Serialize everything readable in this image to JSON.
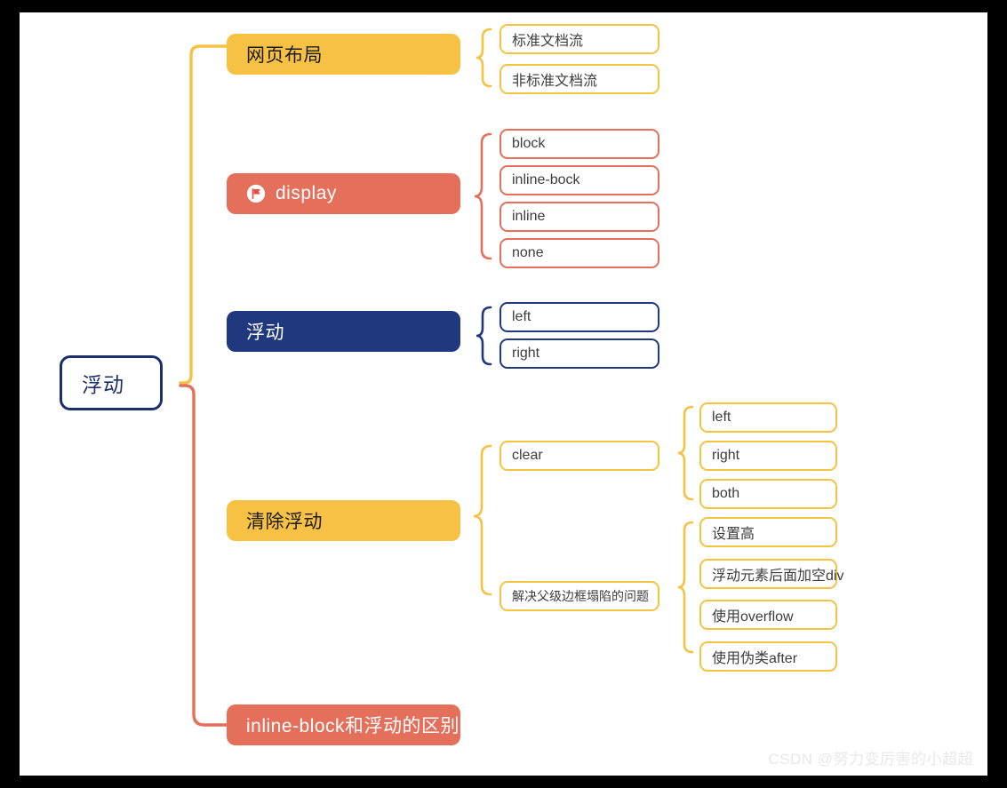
{
  "canvas": {
    "background": "#ffffff",
    "frame_color": "#000000",
    "watermark": "CSDN @努力变厉害的小超超"
  },
  "palette": {
    "amber": "#f7c244",
    "amber_border": "#f5c243",
    "salmon": "#e4705c",
    "navy": "#20387e",
    "root_border": "#1b2f6b",
    "leaf_text": "#3d3d3d",
    "watermark_gray": "#e8e8e8"
  },
  "chart_data": {
    "type": "diagram",
    "diagram_kind": "mind-map",
    "title": "浮动",
    "root": {
      "label": "浮动",
      "style": "outline-navy"
    },
    "branches": [
      {
        "label": "网页布局",
        "style": "filled-amber",
        "trunk": "amber",
        "children": [
          {
            "label": "标准文档流",
            "style": "outline-amber"
          },
          {
            "label": "非标准文档流",
            "style": "outline-amber"
          }
        ]
      },
      {
        "label": "display",
        "style": "filled-salmon",
        "icon": "flag-icon",
        "trunk": "amber",
        "children": [
          {
            "label": "block",
            "style": "outline-salmon"
          },
          {
            "label": "inline-bock",
            "style": "outline-salmon"
          },
          {
            "label": "inline",
            "style": "outline-salmon"
          },
          {
            "label": "none",
            "style": "outline-salmon"
          }
        ]
      },
      {
        "label": "浮动",
        "style": "filled-navy",
        "trunk": "amber",
        "children": [
          {
            "label": "left",
            "style": "outline-navy"
          },
          {
            "label": "right",
            "style": "outline-navy"
          }
        ]
      },
      {
        "label": "清除浮动",
        "style": "filled-amber",
        "trunk": "salmon",
        "children": [
          {
            "label": "clear",
            "style": "outline-amber",
            "children": [
              {
                "label": "left",
                "style": "outline-amber"
              },
              {
                "label": "right",
                "style": "outline-amber"
              },
              {
                "label": "both",
                "style": "outline-amber"
              }
            ]
          },
          {
            "label": "解决父级边框塌陷的问题",
            "style": "outline-amber",
            "small": true,
            "children": [
              {
                "label": "设置高",
                "style": "outline-amber"
              },
              {
                "label": "浮动元素后面加空div",
                "style": "outline-amber"
              },
              {
                "label": "使用overflow",
                "style": "outline-amber"
              },
              {
                "label": "使用伪类after",
                "style": "outline-amber"
              }
            ]
          }
        ]
      },
      {
        "label": "inline-block和浮动的区别",
        "style": "filled-salmon",
        "trunk": "salmon",
        "children": []
      }
    ]
  },
  "nodes": {
    "root": "浮动",
    "b1": "网页布局",
    "b1c1": "标准文档流",
    "b1c2": "非标准文档流",
    "b2": "display",
    "b2c1": "block",
    "b2c2": "inline-bock",
    "b2c3": "inline",
    "b2c4": "none",
    "b3": "浮动",
    "b3c1": "left",
    "b3c2": "right",
    "b4": "清除浮动",
    "b4c1": "clear",
    "b4c1g1": "left",
    "b4c1g2": "right",
    "b4c1g3": "both",
    "b4c2": "解决父级边框塌陷的问题",
    "b4c2g1": "设置高",
    "b4c2g2": "浮动元素后面加空div",
    "b4c2g3": "使用overflow",
    "b4c2g4": "使用伪类after",
    "b5": "inline-block和浮动的区别"
  }
}
